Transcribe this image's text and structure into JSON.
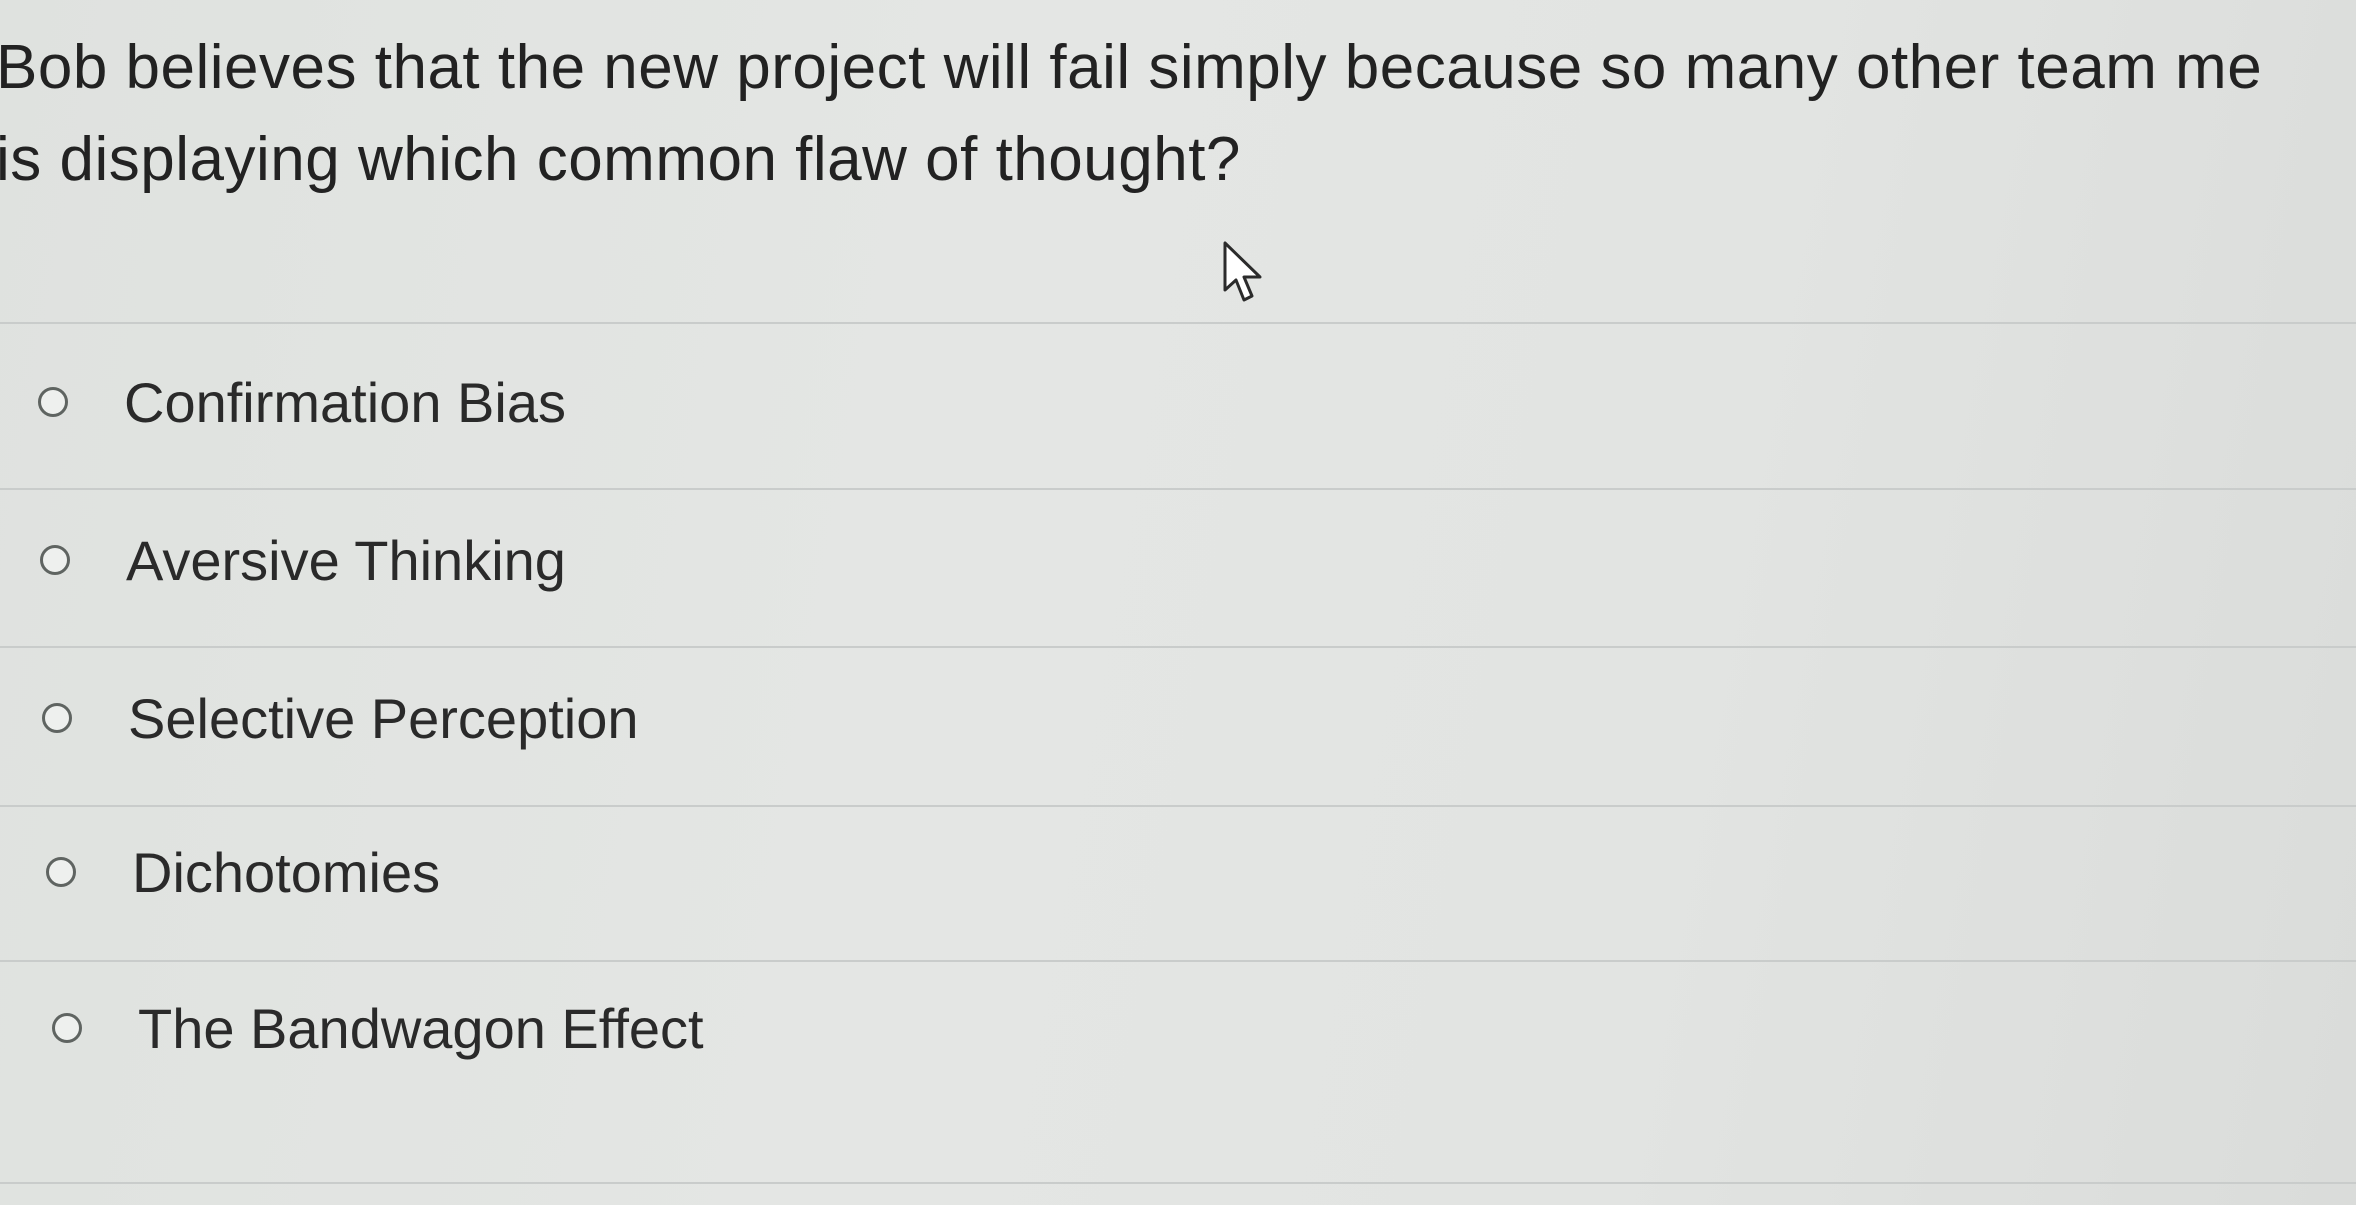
{
  "question": {
    "line1": "Bob believes that the new project will fail simply because so many other team me",
    "line2": "is displaying which common flaw of thought?"
  },
  "options": [
    {
      "label": "Confirmation Bias",
      "selected": false
    },
    {
      "label": "Aversive Thinking",
      "selected": false
    },
    {
      "label": "Selective Perception",
      "selected": false
    },
    {
      "label": "Dichotomies",
      "selected": false
    },
    {
      "label": "The Bandwagon Effect",
      "selected": false
    }
  ],
  "icons": {
    "radio": "radio-button-icon",
    "cursor": "mouse-pointer-icon"
  }
}
